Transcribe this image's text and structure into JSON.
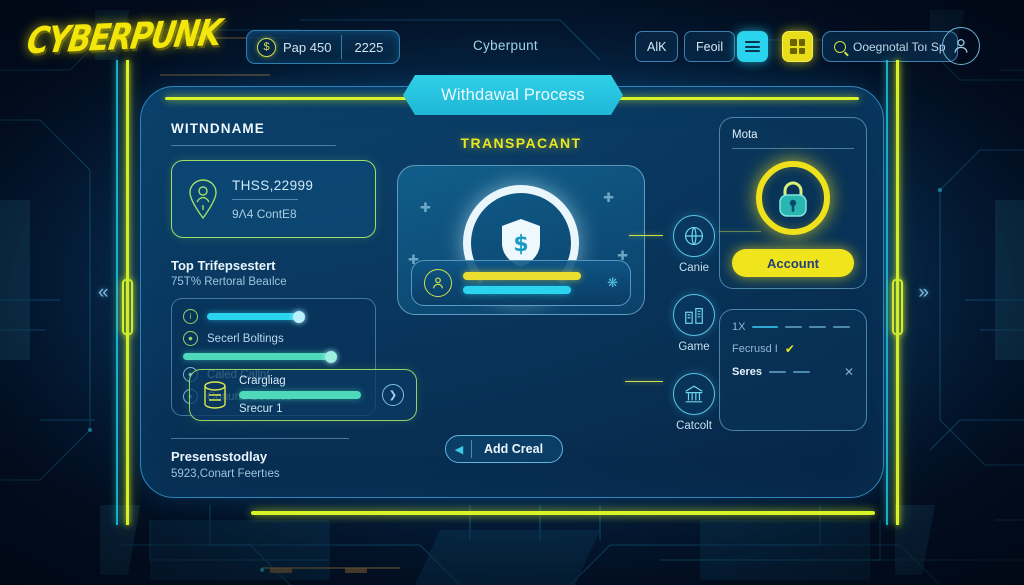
{
  "topbar": {
    "logo": "CYBERPUNK",
    "coin": {
      "icon": "coin-icon",
      "amount": "Pap 450",
      "secondary": "2225"
    },
    "brand_mid": "Cyberpunt",
    "buttons": [
      {
        "name": "tab-alk",
        "label": "AlK"
      },
      {
        "name": "tab-feoil",
        "label": "Feoil"
      }
    ],
    "menu_icon": "hamburger-menu-icon",
    "grid_icon": "grid-apps-icon",
    "search": {
      "icon": "search-icon",
      "text": "Ooegnotal Toı Sp"
    },
    "avatar": "user-avatar-icon"
  },
  "panel": {
    "header_banner": "Withdawal Process"
  },
  "left": {
    "heading": "WITNDNAME",
    "id_card": {
      "icon": "person-pin-icon",
      "primary": "THSS,22999",
      "secondary": "9Λ4 ContE8"
    },
    "section2": {
      "title": "Top Trifepsestert",
      "subtitle": "75T% Rertoral Beaılce"
    },
    "list": [
      {
        "icon": "info-circle-icon",
        "type": "slider",
        "label": "",
        "value": 62
      },
      {
        "icon": "key-circle-icon",
        "type": "item",
        "label": "Secerl Boltings"
      },
      {
        "icon": "",
        "type": "slider",
        "label": "",
        "value": 92
      },
      {
        "icon": "lock-circle-icon",
        "type": "item",
        "label": "Caled Callnt"
      },
      {
        "icon": "gear-circle-icon",
        "type": "item",
        "label": "Conural Setntios"
      }
    ],
    "section3": {
      "title": "Presensstodlay",
      "subtitle": "5923,Conart Feertıes"
    }
  },
  "center": {
    "caption": "TRANSPACANT",
    "hero_icon": "dollar-shield-icon",
    "user_row": {
      "avatar": "user-circle-icon",
      "sparkle": "sparkle-cluster-icon"
    },
    "charge_card": {
      "icon": "database-icon",
      "title": "Crargliag",
      "progress": 72,
      "subtitle": "Srecur 1",
      "next_icon": "chevron-right-icon"
    },
    "add_button": {
      "arrow_icon": "triangle-left-icon",
      "label": "Add Creal"
    }
  },
  "icon_column": [
    {
      "icon": "globe-icon",
      "label": "Canie"
    },
    {
      "icon": "building-icon",
      "label": "Game"
    },
    {
      "icon": "bank-icon",
      "label": "Catcolt"
    }
  ],
  "right": {
    "meta_card": {
      "title": "Mota",
      "lock_icon": "padlock-icon",
      "button": "Account"
    },
    "status_card": {
      "rows": [
        {
          "label": "1X",
          "dashes": 4,
          "mark": ""
        },
        {
          "label": "Fecrusd I",
          "dashes": 0,
          "mark": "check"
        },
        {
          "label": "Seres",
          "dashes": 2,
          "mark": "x"
        }
      ]
    }
  },
  "rails": {
    "left_chevron": "«",
    "right_chevron": "»"
  },
  "colors": {
    "neon_yellow": "#d8f327",
    "neon_cyan": "#2ad4ef",
    "deep_blue": "#062a4c",
    "accent_green": "#8fd36a"
  }
}
